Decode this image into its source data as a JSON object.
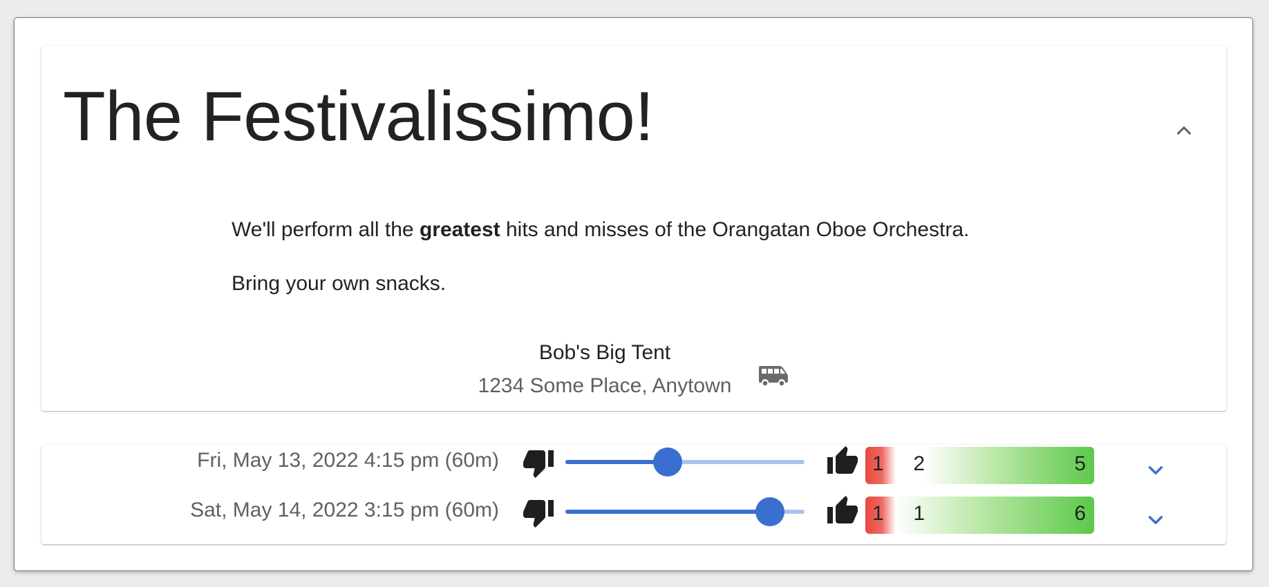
{
  "event": {
    "title": "The Festivalissimo!",
    "collapse_icon": "chevron-up-icon",
    "description": {
      "line1_before": "We'll perform all the ",
      "line1_bold": "greatest",
      "line1_after": " hits and misses of the Orangatan Oboe Orchestra.",
      "line2": "Bring your own snacks."
    },
    "venue": {
      "name": "Bob's Big Tent",
      "address": "1234 Some Place, Anytown",
      "directions_icon": "van-icon"
    }
  },
  "showtimes": [
    {
      "time": "Fri, May 13, 2022 4:15 pm (60m)",
      "rating_fraction": 0.5,
      "votes": {
        "negative": "1",
        "neutral": "2",
        "positive": "5"
      },
      "vote_counts": {
        "negative": 1,
        "neutral": 2,
        "positive": 5
      },
      "expand_icon": "chevron-down-icon"
    },
    {
      "time": "Sat, May 14, 2022 3:15 pm (60m)",
      "rating_fraction": 1.0,
      "votes": {
        "negative": "1",
        "neutral": "1",
        "positive": "6"
      },
      "vote_counts": {
        "negative": 1,
        "neutral": 1,
        "positive": 6
      },
      "expand_icon": "chevron-down-icon"
    }
  ],
  "colors": {
    "accent": "#3a6fd0",
    "accent_light": "#abc4ec",
    "negative": "#e8483f",
    "positive": "#5cc94a"
  }
}
